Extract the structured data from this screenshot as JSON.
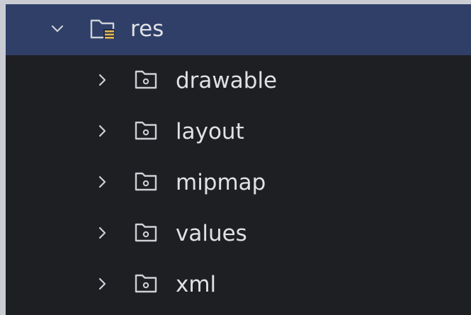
{
  "tree": {
    "root": {
      "label": "res",
      "expanded": true,
      "selected": true,
      "icon": "resource-folder-icon"
    },
    "children": [
      {
        "label": "drawable",
        "expanded": false,
        "icon": "package-folder-icon"
      },
      {
        "label": "layout",
        "expanded": false,
        "icon": "package-folder-icon"
      },
      {
        "label": "mipmap",
        "expanded": false,
        "icon": "package-folder-icon"
      },
      {
        "label": "values",
        "expanded": false,
        "icon": "package-folder-icon"
      },
      {
        "label": "xml",
        "expanded": false,
        "icon": "package-folder-icon"
      }
    ]
  },
  "colors": {
    "background": "#1e1f22",
    "selection": "#2f3f68",
    "text": "#dfe1e5",
    "icon_stroke": "#ced0d6",
    "resource_badge": "#e8b84a",
    "outer_margin": "#c9ccd3"
  }
}
